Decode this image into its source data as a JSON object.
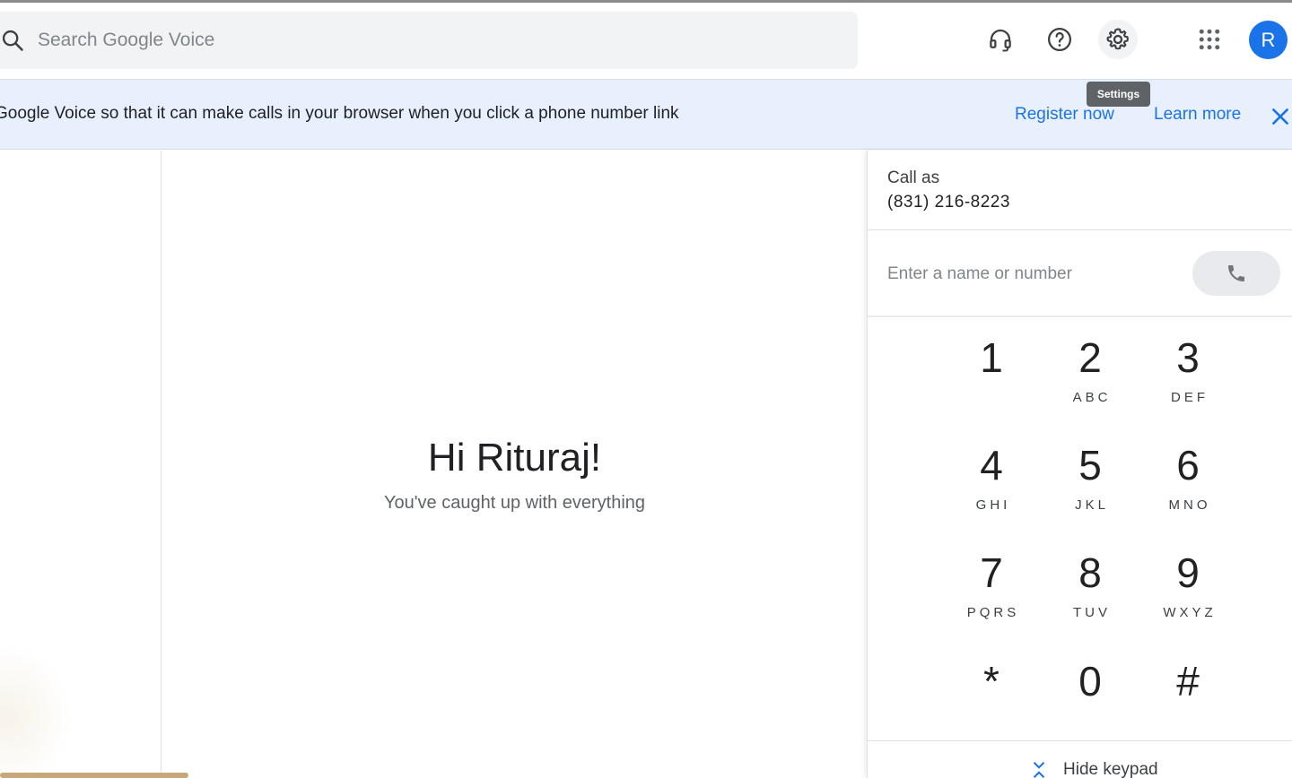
{
  "header": {
    "search_placeholder": "Search Google Voice",
    "icons": [
      "support-icon",
      "help-icon",
      "settings-icon",
      "apps-icon"
    ],
    "avatar_initial": "R"
  },
  "tooltip": {
    "text": "Settings"
  },
  "banner": {
    "text": "Google Voice so that it can make calls in your browser when you click a phone number link",
    "register_label": "Register now",
    "learn_label": "Learn more"
  },
  "main": {
    "greeting": "Hi Rituraj!",
    "subtext": "You've caught up with everything"
  },
  "dialer": {
    "call_as_label": "Call as",
    "call_as_number": "(831) 216-8223",
    "input_placeholder": "Enter a name or number",
    "keys": [
      {
        "digit": "1",
        "letters": ""
      },
      {
        "digit": "2",
        "letters": "ABC"
      },
      {
        "digit": "3",
        "letters": "DEF"
      },
      {
        "digit": "4",
        "letters": "GHI"
      },
      {
        "digit": "5",
        "letters": "JKL"
      },
      {
        "digit": "6",
        "letters": "MNO"
      },
      {
        "digit": "7",
        "letters": "PQRS"
      },
      {
        "digit": "8",
        "letters": "TUV"
      },
      {
        "digit": "9",
        "letters": "WXYZ"
      },
      {
        "digit": "*",
        "letters": ""
      },
      {
        "digit": "0",
        "letters": ""
      },
      {
        "digit": "#",
        "letters": ""
      }
    ],
    "hide_keypad_label": "Hide keypad"
  },
  "colors": {
    "accent": "#1a73e8",
    "banner_bg": "#e8f0fe",
    "search_bg": "#f1f3f4"
  }
}
